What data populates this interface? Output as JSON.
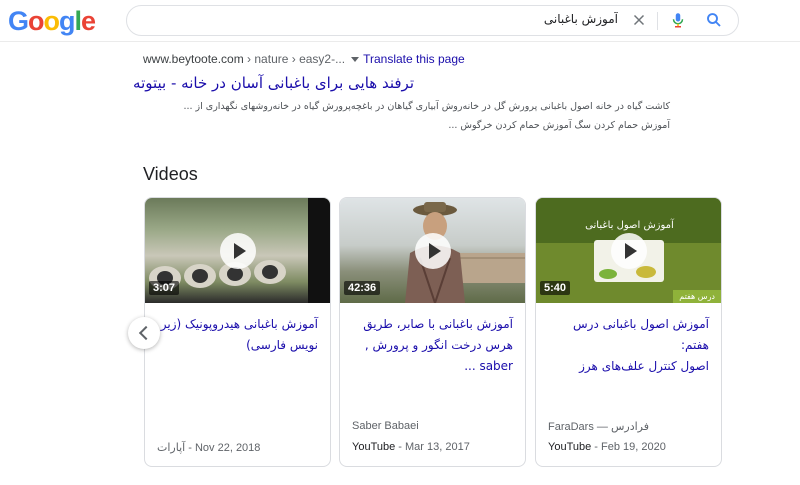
{
  "search": {
    "query": "آموزش باغبانی"
  },
  "result": {
    "domain": "www.beytoote.com",
    "path": " › nature › easy2-...",
    "translate_label": "Translate this page",
    "title": "ترفند هایی برای باغبانی آسان در خانه - بیتوته",
    "snippet_line1": "کاشت گیاه در خانه اصول باغبانی پرورش گل در خانه‌روش آبیاری گیاهان در باغچه‌پرورش گیاه در خانه‌روشهای نگهداری از ...",
    "snippet_line2": "آموزش حمام کردن سگ آموزش حمام کردن خرگوش ..."
  },
  "videos": {
    "heading": "Videos",
    "items": [
      {
        "duration": "3:07",
        "title_line1": "آموزش باغبانی هیدروپونیک (زیر",
        "title_line2": "نویس فارسی)",
        "title_line3": "",
        "channel": "",
        "source": "آپارات",
        "date": " - Nov 22, 2018"
      },
      {
        "duration": "42:36",
        "title_line1": "آموزش باغبانی با صابر، طریق",
        "title_line2": "هرس درخت انگور و پرورش ,",
        "title_line3": "saber ...",
        "channel": "Saber Babaei",
        "source": "YouTube",
        "date": " - Mar 13, 2017"
      },
      {
        "duration": "5:40",
        "thumb_text": "آموزش اصول باغبانی",
        "thumb_tag": "درس هفتم",
        "title_line1": "آموزش اصول باغبانی درس هفتم:",
        "title_line2": "اصول کنترل علف‌های هرز",
        "title_line3": "",
        "channel": "FaraDars — فرادرس",
        "source": "YouTube",
        "date": " - Feb 19, 2020"
      }
    ]
  },
  "colors": {
    "link": "#1a0dab",
    "text": "#202124",
    "meta": "#5f6368",
    "border": "#dadce0"
  },
  "icons": [
    "clear-icon",
    "mic-icon",
    "search-icon",
    "play-icon",
    "chevron-left-icon"
  ]
}
